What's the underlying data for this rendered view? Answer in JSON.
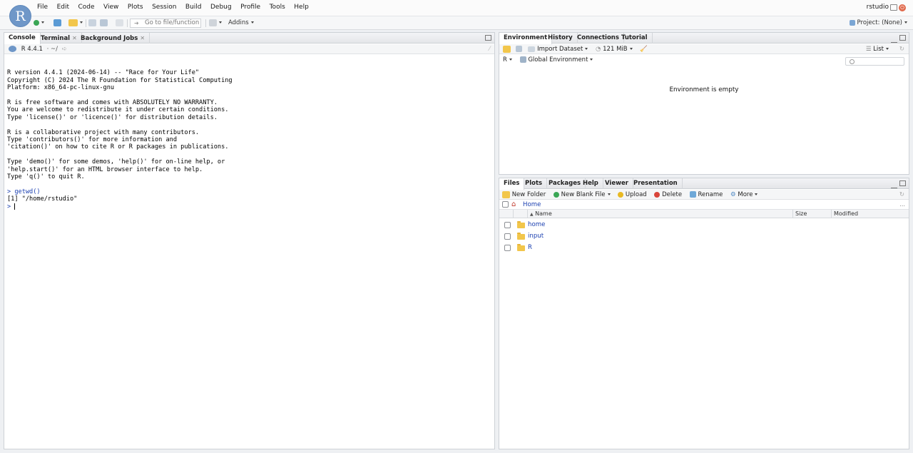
{
  "menu": [
    "File",
    "Edit",
    "Code",
    "View",
    "Plots",
    "Session",
    "Build",
    "Debug",
    "Profile",
    "Tools",
    "Help"
  ],
  "logo_letter": "R",
  "user": "rstudio",
  "toolbar": {
    "goto_placeholder": "Go to file/function",
    "addins": "Addins",
    "project": "Project: (None)"
  },
  "console_pane": {
    "tabs": [
      {
        "label": "Console",
        "closable": false
      },
      {
        "label": "Terminal",
        "closable": true
      },
      {
        "label": "Background Jobs",
        "closable": true
      }
    ],
    "version_label": "R 4.4.1",
    "path": "· ~/",
    "lines": [
      "R version 4.4.1 (2024-06-14) -- \"Race for Your Life\"",
      "Copyright (C) 2024 The R Foundation for Statistical Computing",
      "Platform: x86_64-pc-linux-gnu",
      "",
      "R is free software and comes with ABSOLUTELY NO WARRANTY.",
      "You are welcome to redistribute it under certain conditions.",
      "Type 'license()' or 'licence()' for distribution details.",
      "",
      "R is a collaborative project with many contributors.",
      "Type 'contributors()' for more information and",
      "'citation()' on how to cite R or R packages in publications.",
      "",
      "Type 'demo()' for some demos, 'help()' for on-line help, or",
      "'help.start()' for an HTML browser interface to help.",
      "Type 'q()' to quit R.",
      ""
    ],
    "command": "> getwd()",
    "output": "[1] \"/home/rstudio\"",
    "prompt": ">"
  },
  "env_pane": {
    "tabs": [
      "Environment",
      "History",
      "Connections",
      "Tutorial"
    ],
    "import_dataset": "Import Dataset",
    "memory": "121 MiB",
    "view_mode": "List",
    "language": "R",
    "scope": "Global Environment",
    "empty_message": "Environment is empty"
  },
  "files_pane": {
    "tabs": [
      "Files",
      "Plots",
      "Packages",
      "Help",
      "Viewer",
      "Presentation"
    ],
    "actions": {
      "new_folder": "New Folder",
      "new_blank_file": "New Blank File",
      "upload": "Upload",
      "delete": "Delete",
      "rename": "Rename",
      "more": "More"
    },
    "breadcrumb": "Home",
    "columns": {
      "name": "Name",
      "size": "Size",
      "modified": "Modified"
    },
    "rows": [
      "home",
      "input",
      "R"
    ],
    "more_ellipsis": "..."
  }
}
